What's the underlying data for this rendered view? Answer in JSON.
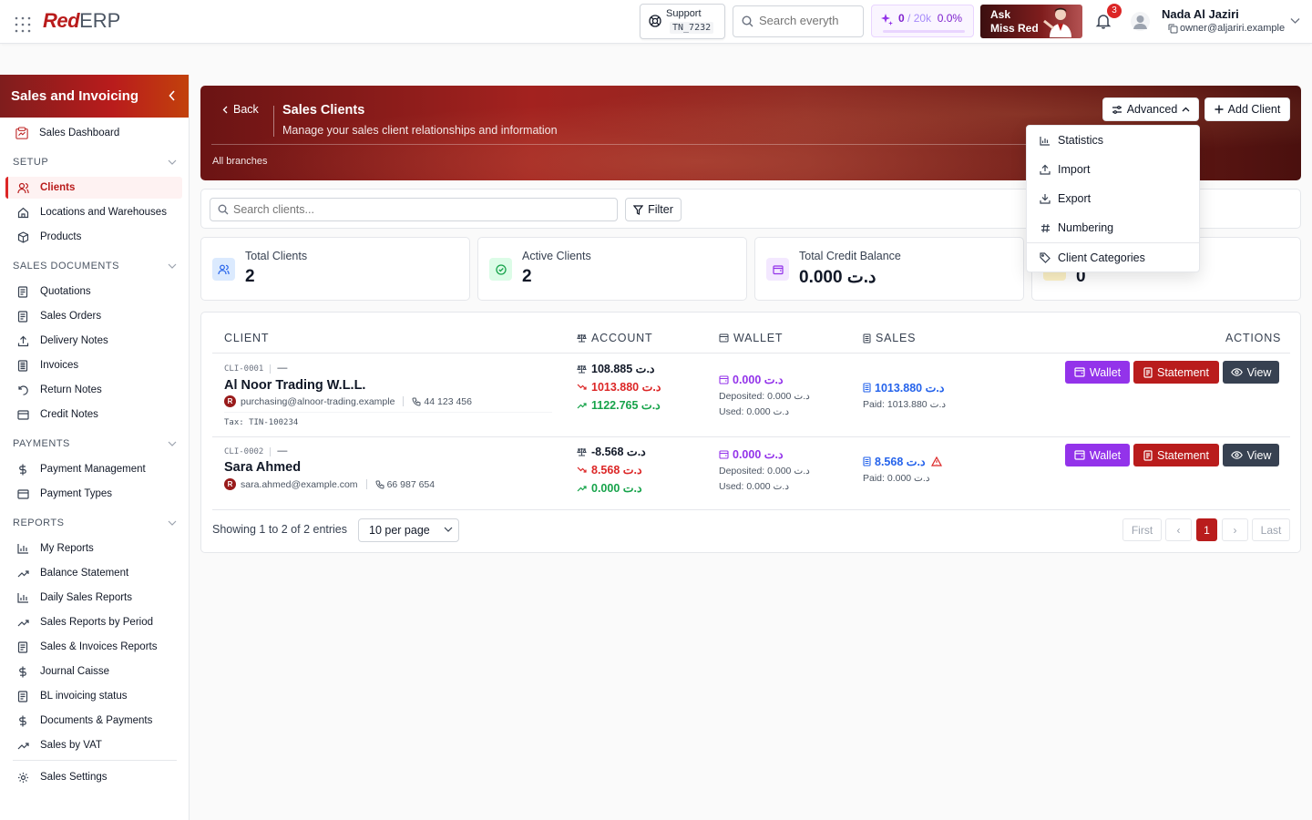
{
  "topbar": {
    "logo_red": "Red",
    "logo_erp": "ERP",
    "support_label": "Support",
    "support_code": "TN_7232",
    "search_placeholder": "Search everyth",
    "credits_used": "0",
    "credits_sep": "/",
    "credits_total": "20k",
    "credits_pct": "0.0%",
    "credits_fraction": 0.0,
    "ask_line1": "Ask",
    "ask_line2": "Miss Red",
    "notifications_count": "3",
    "user_name": "Nada Al Jaziri",
    "user_email": "owner@aljariri.example"
  },
  "sidebar": {
    "title": "Sales and Invoicing",
    "dashboard": "Sales Dashboard",
    "sections": {
      "setup": "SETUP",
      "sales_documents": "SALES DOCUMENTS",
      "payments": "PAYMENTS",
      "reports": "REPORTS"
    },
    "items": {
      "clients": "Clients",
      "locations": "Locations and Warehouses",
      "products": "Products",
      "quotations": "Quotations",
      "sales_orders": "Sales Orders",
      "delivery_notes": "Delivery Notes",
      "invoices": "Invoices",
      "return_notes": "Return Notes",
      "credit_notes": "Credit Notes",
      "payment_management": "Payment Management",
      "payment_types": "Payment Types",
      "my_reports": "My Reports",
      "balance_statement": "Balance Statement",
      "daily_sales_reports": "Daily Sales Reports",
      "sales_reports_by_period": "Sales Reports by Period",
      "sales_invoices_reports": "Sales & Invoices Reports",
      "journal_caisse": "Journal Caisse",
      "bl_invoicing_status": "BL invoicing status",
      "documents_payments": "Documents & Payments",
      "sales_by_vat": "Sales by VAT",
      "sales_settings": "Sales Settings"
    }
  },
  "header": {
    "back": "Back",
    "title": "Sales Clients",
    "subtitle": "Manage your sales client relationships and information",
    "branch": "All branches",
    "advanced": "Advanced",
    "add_client": "Add Client"
  },
  "advanced_menu": {
    "statistics": "Statistics",
    "import": "Import",
    "export": "Export",
    "numbering": "Numbering",
    "client_categories": "Client Categories"
  },
  "search": {
    "placeholder": "Search clients...",
    "filter": "Filter"
  },
  "stats": [
    {
      "label": "Total Clients",
      "value": "2"
    },
    {
      "label": "Active Clients",
      "value": "2"
    },
    {
      "label": "Total Credit Balance",
      "value": "0.000 د.ت"
    },
    {
      "label": "",
      "value": "0"
    }
  ],
  "table": {
    "headers": {
      "client": "CLIENT",
      "account": "ACCOUNT",
      "wallet": "WALLET",
      "sales": "SALES",
      "actions": "ACTIONS"
    },
    "rows": [
      {
        "code": "CLI-0001",
        "dash": "—",
        "name": "Al Noor Trading W.L.L.",
        "badge": "R",
        "email": "purchasing@alnoor-trading.example",
        "phone": "44 123 456",
        "tax": "Tax: TIN-100234",
        "balance": "108.885 د.ت",
        "debit": "1013.880 د.ت",
        "credit": "1122.765 د.ت",
        "wallet": "0.000 د.ت",
        "deposited": "Deposited: 0.000 د.ت",
        "used": "Used: 0.000 د.ت",
        "sales": "1013.880 د.ت",
        "paid": "Paid: 1013.880 د.ت"
      },
      {
        "code": "CLI-0002",
        "dash": "—",
        "name": "Sara Ahmed",
        "badge": "R",
        "email": "sara.ahmed@example.com",
        "phone": "66 987 654",
        "balance": "-8.568 د.ت",
        "debit": "8.568 د.ت",
        "credit": "0.000 د.ت",
        "wallet": "0.000 د.ت",
        "deposited": "Deposited: 0.000 د.ت",
        "used": "Used: 0.000 د.ت",
        "sales": "8.568 د.ت",
        "paid": "Paid: 0.000 د.ت"
      }
    ],
    "actions": {
      "wallet": "Wallet",
      "statement": "Statement",
      "view": "View"
    }
  },
  "pagination": {
    "showing": "Showing 1 to 2 of 2 entries",
    "per_page": "10 per page",
    "first": "First",
    "prev": "‹",
    "current": "1",
    "next": "›",
    "last": "Last"
  }
}
